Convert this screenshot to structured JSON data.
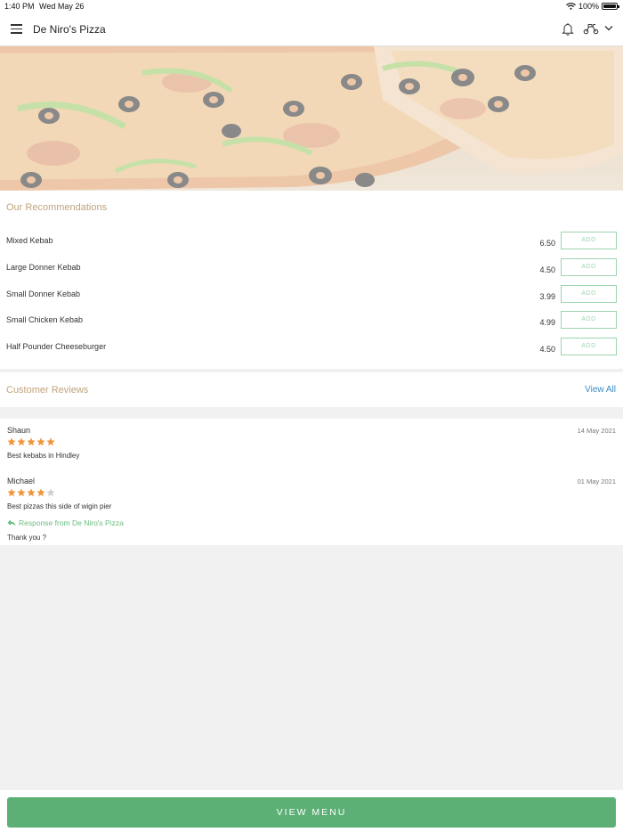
{
  "status_bar": {
    "time": "1:40 PM",
    "date": "Wed May 26",
    "battery": "100%",
    "battery_level": 1.0
  },
  "header": {
    "title": "De Niro's Pizza",
    "icons": [
      "menu-icon",
      "bell-icon",
      "scooter-icon",
      "chevron-down-icon"
    ]
  },
  "recommendations": {
    "title": "Our Recommendations",
    "add_label": "ADD",
    "items": [
      {
        "name": "Mixed Kebab",
        "price": "6.50"
      },
      {
        "name": "Large Donner Kebab",
        "price": "4.50"
      },
      {
        "name": "Small Donner Kebab",
        "price": "3.99"
      },
      {
        "name": "Small Chicken Kebab",
        "price": "4.99"
      },
      {
        "name": "Half Pounder Cheeseburger",
        "price": "4.50"
      }
    ]
  },
  "reviews": {
    "title": "Customer Reviews",
    "view_all": "View All",
    "items": [
      {
        "name": "Shaun",
        "date": "14 May 2021",
        "rating": 5,
        "text": "Best kebabs in Hindley"
      },
      {
        "name": "Michael",
        "date": "01 May 2021",
        "rating": 4,
        "text": "Best pizzas this side of wigin pier",
        "response_label": "Response from De Niro's Pizza",
        "response_text": "Thank you ?"
      }
    ]
  },
  "footer": {
    "view_menu": "VIEW MENU"
  },
  "colors": {
    "accent_green": "#5cb075",
    "section_title": "#c1a37b",
    "link_blue": "#3b8cc4",
    "star_orange": "#f0953b",
    "star_grey": "#cfcfcf"
  }
}
